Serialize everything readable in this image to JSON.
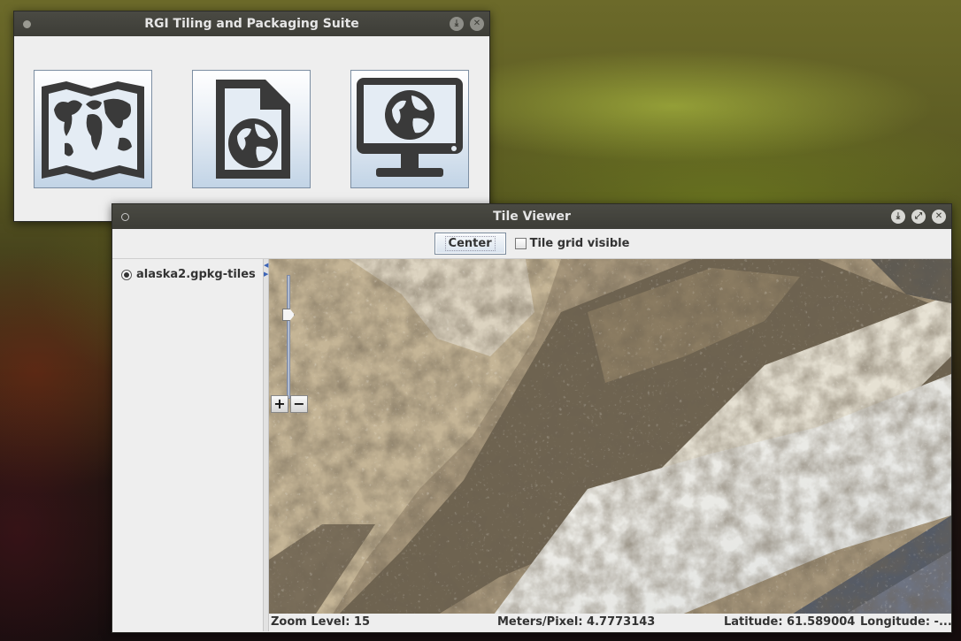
{
  "suite_window": {
    "title": "RGI Tiling and Packaging Suite",
    "tools": [
      {
        "icon": "world-map-icon"
      },
      {
        "icon": "globe-document-icon"
      },
      {
        "icon": "globe-monitor-icon"
      }
    ]
  },
  "viewer_window": {
    "title": "Tile Viewer",
    "toolbar": {
      "center_label": "Center",
      "tile_grid_label": "Tile grid visible",
      "tile_grid_checked": false
    },
    "tree": {
      "items": [
        {
          "label": "alaska2.gpkg-tiles",
          "selected": true
        }
      ]
    },
    "zoom_controls": {
      "plus": "+",
      "minus": "−",
      "slider_level": 0.3
    },
    "status": {
      "zoom_level": "Zoom Level: 15",
      "meters_per_pixel": "Meters/Pixel: 4.7773143",
      "latitude": "Latitude: 61.589004",
      "longitude": "Longitude: -..."
    }
  },
  "colors": {
    "titlebar": "#3d3d37",
    "window_bg": "#eeeeee",
    "icon_dark": "#3a3a3a",
    "button_gradient_bottom": "#c2d4e6"
  }
}
